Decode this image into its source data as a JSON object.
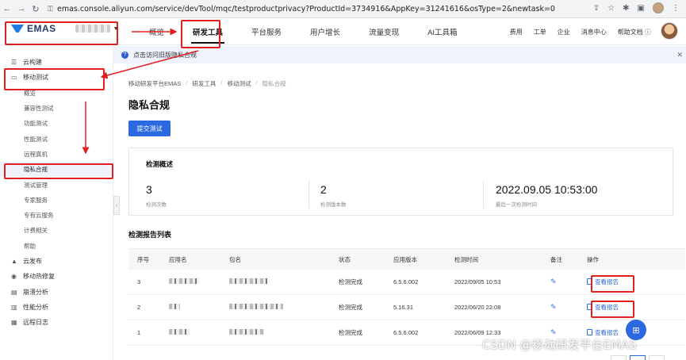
{
  "browser": {
    "url": "emas.console.aliyun.com/service/devTool/mqc/testproductprivacy?ProductId=3734916&AppKey=31241616&osType=2&newtask=0",
    "back_icon": "arrow-left-icon",
    "forward_icon": "arrow-right-icon",
    "reload_icon": "reload-icon"
  },
  "header": {
    "logo_text": "EMAS",
    "top_nav": [
      "概览",
      "研发工具",
      "平台服务",
      "用户增长",
      "流量变现",
      "AI工具箱"
    ],
    "active_tab": "研发工具",
    "right_links": [
      "费用",
      "工单",
      "企业",
      "消息中心",
      "帮助文档"
    ]
  },
  "sidebar": {
    "items": [
      {
        "label": "云构建",
        "icon": "server-icon"
      },
      {
        "label": "移动测试",
        "icon": "monitor-icon"
      }
    ],
    "sub_items": [
      "概览",
      "兼容性测试",
      "功能测试",
      "性能测试",
      "远程真机",
      "隐私合规",
      "测试管理",
      "专家服务",
      "专有云服务",
      "计费相关",
      "帮助"
    ],
    "active_sub": "隐私合规",
    "more_items": [
      {
        "label": "云发布",
        "icon": "rocket-icon"
      },
      {
        "label": "移动热修复",
        "icon": "patch-icon"
      },
      {
        "label": "崩溃分析",
        "icon": "crash-icon"
      },
      {
        "label": "性能分析",
        "icon": "chart-icon"
      },
      {
        "label": "远程日志",
        "icon": "log-icon"
      }
    ]
  },
  "notice": {
    "text": "点击访问旧版隐私合规"
  },
  "main": {
    "breadcrumb": [
      "移动研发平台EMAS",
      "研发工具",
      "移动测试",
      "隐私合规"
    ],
    "title": "隐私合规",
    "submit_button": "提交测试",
    "summary": {
      "title": "检测概述",
      "stats": [
        {
          "value": "3",
          "label": "检测次数"
        },
        {
          "value": "2",
          "label": "检测版本数"
        },
        {
          "value": "2022.09.05 10:53:00",
          "label": "最后一次检测时间"
        }
      ]
    },
    "list_title": "检测报告列表",
    "table": {
      "headers": [
        "序号",
        "应用名",
        "包名",
        "状态",
        "应用版本",
        "检测时间",
        "备注",
        "操作"
      ],
      "rows": [
        {
          "idx": "3",
          "status": "检测完成",
          "version": "6.5.6.002",
          "time": "2022/09/05 10:53",
          "action": "查看报告"
        },
        {
          "idx": "2",
          "status": "检测完成",
          "version": "5.16.31",
          "time": "2022/06/20 22:08",
          "action": "查看报告"
        },
        {
          "idx": "1",
          "status": "检测完成",
          "version": "6.5.6.002",
          "time": "2022/06/09 12:33",
          "action": "查看报告"
        }
      ]
    }
  },
  "watermark": "CSDN @移动研发平台EMAS",
  "colors": {
    "primary": "#2c68e0",
    "annotation": "#e02020",
    "notice_bg": "#eef3fe"
  }
}
